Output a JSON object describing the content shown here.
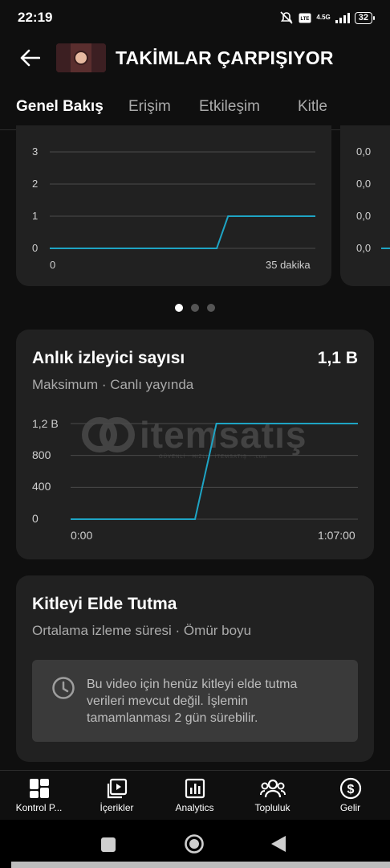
{
  "status": {
    "time": "22:19",
    "network": "4.5G",
    "volte": "VoLTE",
    "battery": "32"
  },
  "header": {
    "title": "TAKİMLAR ÇARPIŞIYOR"
  },
  "tabs": [
    "Genel Bakış",
    "Erişim",
    "Etkileşim",
    "Kitle"
  ],
  "carousel": {
    "card1": {
      "y_ticks": [
        "3",
        "2",
        "1",
        "0"
      ],
      "x_start": "0",
      "x_end": "35 dakika"
    },
    "card2": {
      "y_ticks": [
        "0,0",
        "0,0",
        "0,0",
        "0,0"
      ]
    },
    "page_count": 3,
    "active_page": 1
  },
  "live_viewers": {
    "title": "Anlık izleyici sayısı",
    "value": "1,1 B",
    "subtitle": "Maksimum · Canlı yayında",
    "y_ticks": [
      "1,2 B",
      "800",
      "400",
      "0"
    ],
    "x_start": "0:00",
    "x_end": "1:07:00",
    "watermark": "itemsatış",
    "watermark_sub": "GÜVENLİ · HIZLI · İTEMSATIŞ · .com"
  },
  "retention": {
    "title": "Kitleyi Elde Tutma",
    "subtitle": "Ortalama izleme süresi · Ömür boyu",
    "message": "Bu video için henüz kitleyi elde tutma verileri mevcut değil. İşlemin tamamlanması 2 gün sürebilir."
  },
  "bottom_nav": [
    {
      "label": "Kontrol P...",
      "icon": "dashboard-icon"
    },
    {
      "label": "İçerikler",
      "icon": "content-icon"
    },
    {
      "label": "Analytics",
      "icon": "analytics-icon"
    },
    {
      "label": "Topluluk",
      "icon": "community-icon"
    },
    {
      "label": "Gelir",
      "icon": "earn-icon"
    }
  ],
  "colors": {
    "accent": "#1ea4c4",
    "card": "#212121",
    "background": "#0f0f0f"
  },
  "chart_data": [
    {
      "type": "line",
      "x": [
        0,
        22,
        23.5,
        35
      ],
      "y": [
        0,
        0,
        1,
        1
      ],
      "xlabel": "",
      "ylabel": "",
      "ylim": [
        0,
        3
      ],
      "x_tick_labels": [
        "0",
        "35 dakika"
      ],
      "y_tick_labels": [
        "0",
        "1",
        "2",
        "3"
      ],
      "grid": true
    },
    {
      "type": "line",
      "x": [
        0,
        29,
        34,
        67
      ],
      "y": [
        0,
        0,
        1200,
        1200
      ],
      "xlabel": "",
      "ylabel": "",
      "ylim": [
        0,
        1200
      ],
      "x_tick_labels": [
        "0:00",
        "1:07:00"
      ],
      "y_tick_labels": [
        "0",
        "400",
        "800",
        "1,2 B"
      ],
      "grid": true
    }
  ]
}
